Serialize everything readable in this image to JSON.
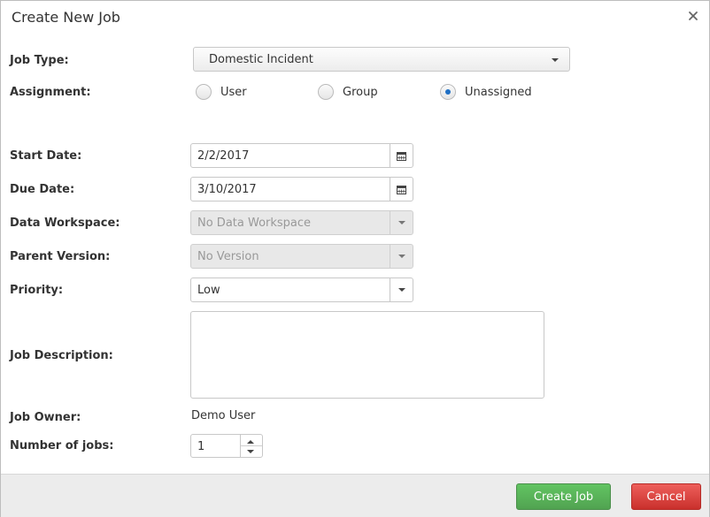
{
  "dialog": {
    "title": "Create New Job"
  },
  "icons": {
    "close": "close-icon",
    "calendar": "calendar-icon",
    "dropdown": "chevron-down-icon"
  },
  "fields": {
    "job_type": {
      "label": "Job Type:",
      "value": "Domestic Incident"
    },
    "assignment": {
      "label": "Assignment:",
      "options": [
        "User",
        "Group",
        "Unassigned"
      ],
      "selected": "Unassigned"
    },
    "start_date": {
      "label": "Start Date:",
      "value": "2/2/2017"
    },
    "due_date": {
      "label": "Due Date:",
      "value": "3/10/2017"
    },
    "data_workspace": {
      "label": "Data Workspace:",
      "value": "No Data Workspace"
    },
    "parent_version": {
      "label": "Parent Version:",
      "value": "No Version"
    },
    "priority": {
      "label": "Priority:",
      "value": "Low"
    },
    "job_description": {
      "label": "Job Description:",
      "value": ""
    },
    "job_owner": {
      "label": "Job Owner:",
      "value": "Demo User"
    },
    "number_of_jobs": {
      "label": "Number of jobs:",
      "value": "1"
    }
  },
  "footer": {
    "create_label": "Create Job",
    "cancel_label": "Cancel"
  },
  "colors": {
    "create": "#5bb75b",
    "cancel": "#da4f49",
    "radio_dot": "#1f6fc4"
  }
}
